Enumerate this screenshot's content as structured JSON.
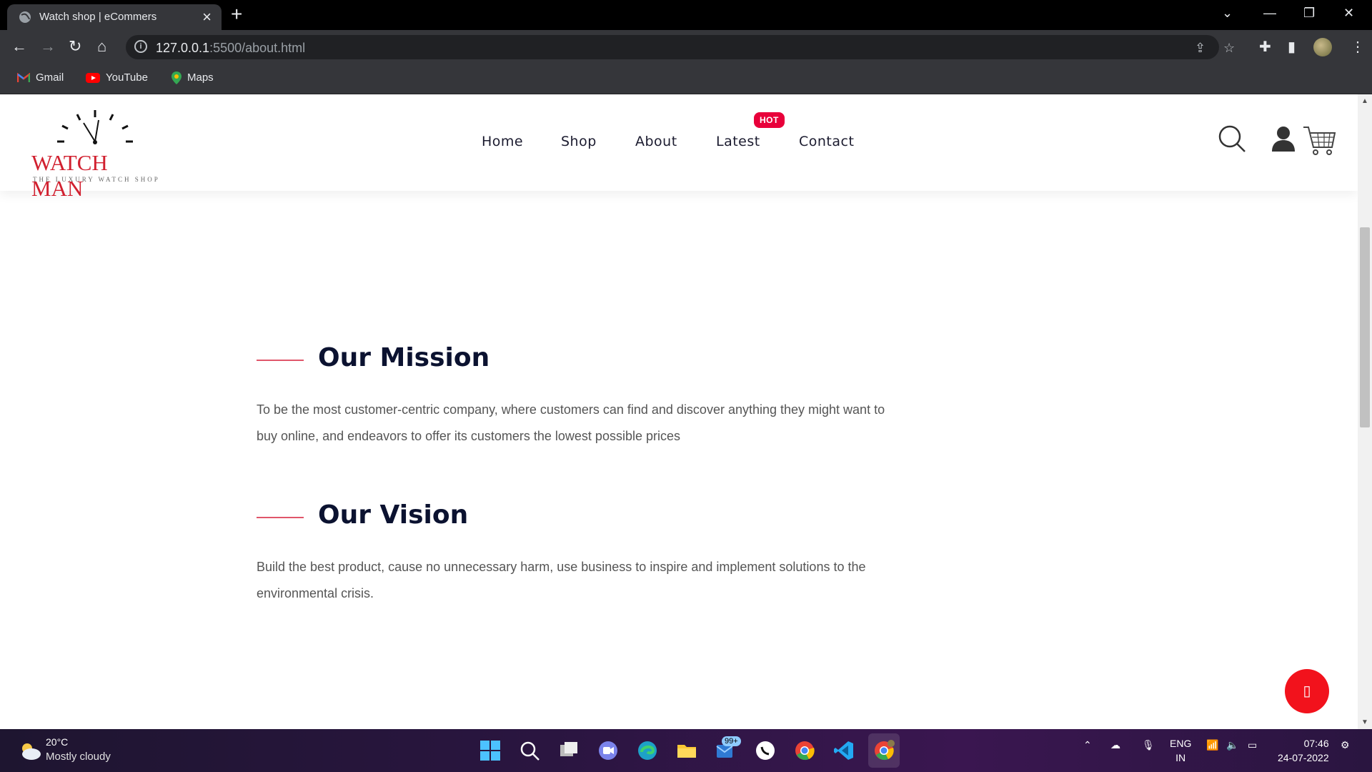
{
  "browser": {
    "tab_title": "Watch shop | eCommers",
    "url_host": "127.0.0.1",
    "url_rest": ":5500/about.html",
    "bookmarks": [
      {
        "label": "Gmail",
        "icon": "gmail-icon"
      },
      {
        "label": "YouTube",
        "icon": "youtube-icon"
      },
      {
        "label": "Maps",
        "icon": "maps-icon"
      }
    ]
  },
  "site": {
    "logo_text": "WATCH MAN",
    "logo_tagline": "THE LUXURY WATCH SHOP",
    "nav": [
      {
        "label": "Home"
      },
      {
        "label": "Shop"
      },
      {
        "label": "About"
      },
      {
        "label": "Latest"
      },
      {
        "label": "Contact"
      }
    ],
    "hot_badge": "HOT",
    "accent_color": "#d1202f"
  },
  "content": {
    "mission_title": "Our Mission",
    "mission_text": "To be the most customer-centric company, where customers can find and discover anything they might want to buy online, and endeavors to offer its customers the lowest possible prices",
    "vision_title": "Our Vision",
    "vision_text": "Build the best product, cause no unnecessary harm, use business to inspire and implement solutions to the environmental crisis."
  },
  "fab": {
    "icon": "back-to-top-icon",
    "glyph": "▯"
  },
  "taskbar": {
    "weather_temp": "20°C",
    "weather_cond": "Mostly cloudy",
    "mail_badge": "99+",
    "lang_line1": "ENG",
    "lang_line2": "IN",
    "time": "07:46",
    "date": "24-07-2022"
  }
}
